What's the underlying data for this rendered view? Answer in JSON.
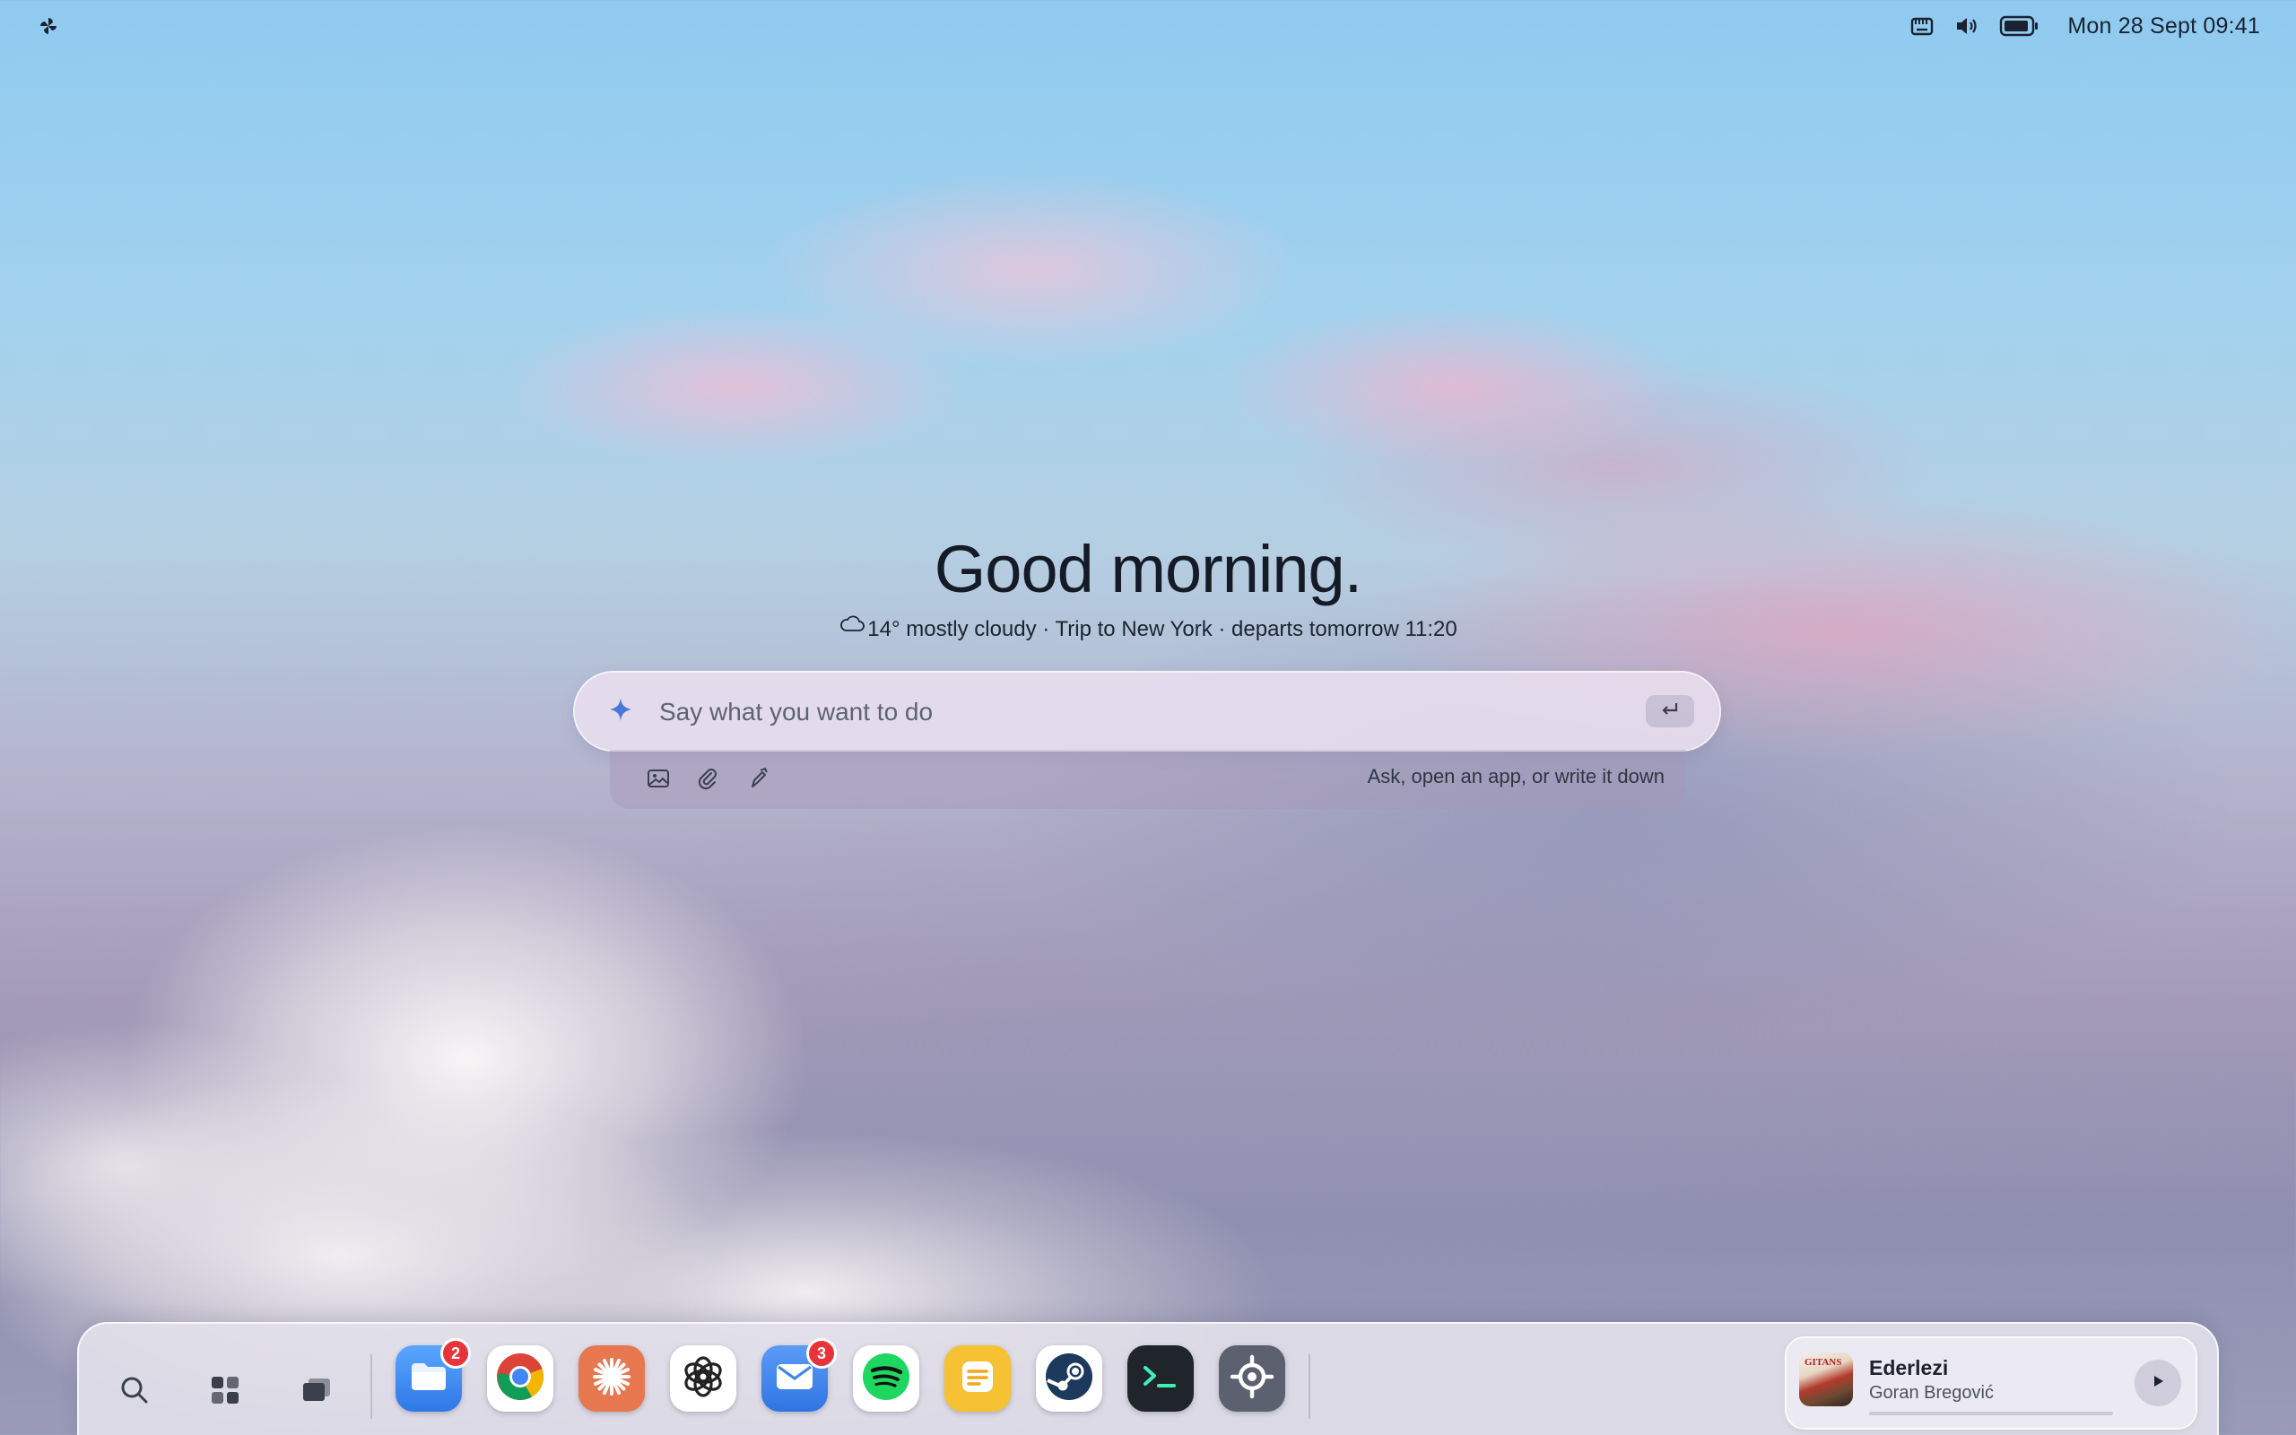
{
  "topbar": {
    "logo_icon": "pinwheel-icon",
    "tray_icons": [
      "storage-icon",
      "volume-icon",
      "battery-icon"
    ],
    "clock": "Mon 28 Sept 09:41"
  },
  "home": {
    "greeting": "Good morning.",
    "weather_icon": "cloud-icon",
    "subline": "14° mostly cloudy · Trip to New York · departs tomorrow 11:20",
    "prompt": {
      "placeholder": "Say what you want to do",
      "value": "",
      "sparkle_icon": "sparkle-icon",
      "submit_icon": "enter-icon"
    },
    "tools": {
      "items": [
        "image-icon",
        "paperclip-icon",
        "pen-icon"
      ],
      "hint": "Ask, open an app, or write it down"
    }
  },
  "dock": {
    "utilities": [
      "search-icon",
      "app-grid-icon",
      "windows-icon"
    ],
    "apps": [
      {
        "name": "Files",
        "icon": "folder-icon",
        "badge": "2",
        "color": "#3d8ef0"
      },
      {
        "name": "Chrome",
        "icon": "chrome-icon",
        "badge": "",
        "color": "#ffffff"
      },
      {
        "name": "Claude",
        "icon": "claude-icon",
        "badge": "",
        "color": "#e7774f"
      },
      {
        "name": "ChatGPT",
        "icon": "openai-icon",
        "badge": "",
        "color": "#ffffff"
      },
      {
        "name": "Mail",
        "icon": "mail-icon",
        "badge": "3",
        "color": "#3f86ec"
      },
      {
        "name": "Spotify",
        "icon": "spotify-icon",
        "badge": "",
        "color": "#ffffff"
      },
      {
        "name": "Notes",
        "icon": "notes-icon",
        "badge": "",
        "color": "#f6c234"
      },
      {
        "name": "Steam",
        "icon": "steam-icon",
        "badge": "",
        "color": "#ffffff"
      },
      {
        "name": "Terminal",
        "icon": "terminal-icon",
        "badge": "",
        "color": "#20242b"
      },
      {
        "name": "Settings",
        "icon": "settings-icon",
        "badge": "",
        "color": "#5c6170"
      }
    ],
    "now_playing": {
      "title": "Ederlezi",
      "artist": "Goran Bregović",
      "cover_caption": "GITANS",
      "progress": 0,
      "play_icon": "play-icon"
    }
  }
}
